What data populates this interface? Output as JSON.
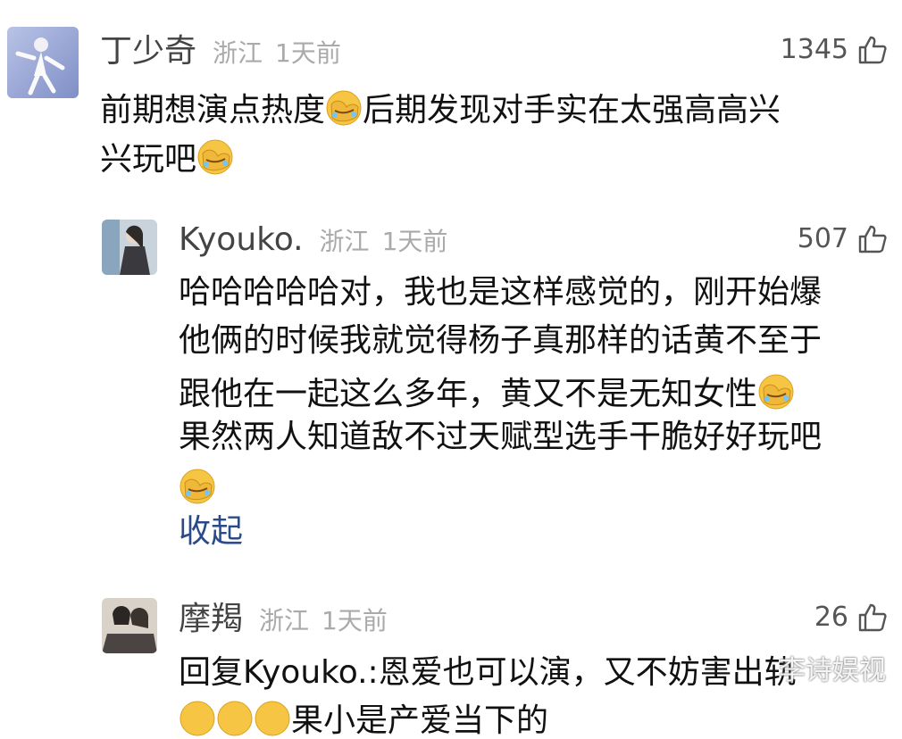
{
  "comments": [
    {
      "name": "丁少奇",
      "location": "浙江",
      "time": "1天前",
      "likes": "1345",
      "lines": [
        "前期想演点热度",
        "后期发现对手实在太强高高兴",
        "兴玩吧"
      ]
    },
    {
      "name": "Kyouko.",
      "location": "浙江",
      "time": "1天前",
      "likes": "507",
      "lines": [
        "哈哈哈哈哈对，我也是这样感觉的，刚开始爆",
        "他俩的时候我就觉得杨子真那样的话黄不至于",
        "跟他在一起这么多年，黄又不是无知女性",
        "果然两人知道敌不过天赋型选手干脆好好玩吧"
      ],
      "collapse_label": "收起"
    },
    {
      "name": "摩羯",
      "location": "浙江",
      "time": "1天前",
      "likes": "26",
      "lines": [
        "回复Kyouko.:恩爱也可以演，又不妨害出轨",
        "果小是产爱当下的"
      ]
    }
  ],
  "watermark": "李诗娱视",
  "icons": {
    "like": "thumbs-up-icon",
    "emoji": "facepalm-laugh-emoji"
  }
}
